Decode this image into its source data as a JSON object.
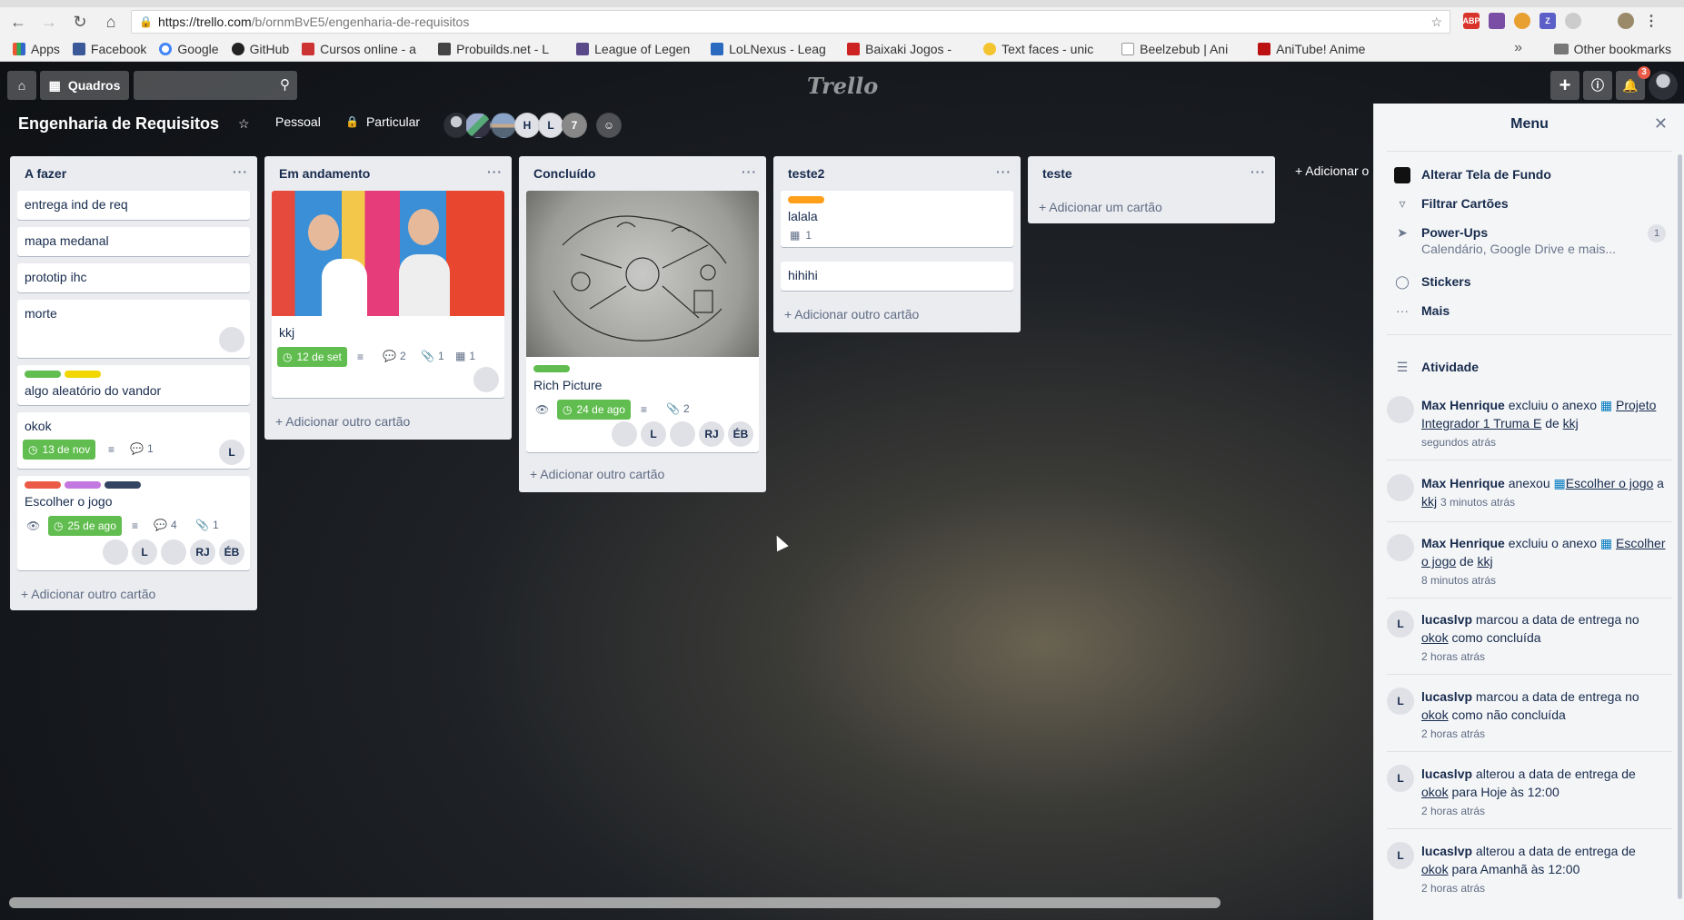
{
  "browser": {
    "url_host": "https://trello.com",
    "url_path": "/b/ornmBvE5/engenharia-de-requisitos",
    "bookmarks": [
      "Apps",
      "Facebook",
      "Google",
      "GitHub",
      "Cursos online - a",
      "Probuilds.net - L",
      "League of Legen",
      "LoLNexus - Leag",
      "Baixaki Jogos -",
      "Text faces - unic",
      "Beelzebub | Ani",
      "AniTube! Anime"
    ],
    "more": "»",
    "other_bookmarks": "Other bookmarks",
    "extensions": [
      "ABP",
      "",
      "",
      "Z",
      "",
      ""
    ]
  },
  "header": {
    "boards_label": "Quadros",
    "logo": "Trello",
    "notif_count": "3"
  },
  "board": {
    "title": "Engenharia de Requisitos",
    "team": "Pessoal",
    "visibility": "Particular",
    "members": [
      "",
      "",
      "",
      "H",
      "L",
      "7"
    ]
  },
  "lists": [
    {
      "name": "A fazer",
      "cards": [
        "entrega ind de req",
        "mapa medanal",
        "prototip ihc",
        "morte",
        "algo aleatório do vandor",
        "okok",
        "Escolher o jogo"
      ],
      "okok": {
        "date": "13 de nov",
        "comments": "1",
        "member": "L"
      },
      "jogo": {
        "date": "25 de ago",
        "comments": "4",
        "attachments": "1",
        "members": [
          "L",
          "RJ",
          "ÉB"
        ]
      },
      "add": "Adicionar outro cartão"
    },
    {
      "name": "Em andamento",
      "cards": [
        "kkj"
      ],
      "kkj": {
        "date": "12 de set",
        "comments": "2",
        "attachments": "1",
        "checklist": "1"
      },
      "add": "Adicionar outro cartão"
    },
    {
      "name": "Concluído",
      "cards": [
        "Rich Picture"
      ],
      "rich": {
        "date": "24 de ago",
        "attachments": "2",
        "members": [
          "L",
          "RJ",
          "ÉB"
        ]
      },
      "add": "Adicionar outro cartão"
    },
    {
      "name": "teste2",
      "cards": [
        "lalala",
        "hihihi"
      ],
      "lalala": {
        "checklist": "1"
      },
      "add": "Adicionar outro cartão"
    },
    {
      "name": "teste",
      "cards": [],
      "add": "Adicionar um cartão"
    }
  ],
  "add_list": "Adicionar o",
  "menu": {
    "title": "Menu",
    "items": [
      "Alterar Tela de Fundo",
      "Filtrar Cartões",
      "Power-Ups",
      "Stickers",
      "Mais"
    ],
    "powerups_sub": "Calendário, Google Drive e mais...",
    "powerups_count": "1",
    "activity_title": "Atividade",
    "activity": [
      {
        "user": "Max Henrique",
        "pre": "excluiu o anexo",
        "link": "Projeto Integrador 1 Truma E",
        "mid": "de",
        "target": "kkj",
        "time": "segundos atrás"
      },
      {
        "user": "Max Henrique",
        "pre": "anexou",
        "link": "Escolher o jogo",
        "mid": "a",
        "target": "kkj",
        "time": "3 minutos atrás"
      },
      {
        "user": "Max Henrique",
        "pre": "excluiu o anexo",
        "link": "Escolher o jogo",
        "mid": "de",
        "target": "kkj",
        "time": "8 minutos atrás"
      },
      {
        "user": "lucaslvp",
        "pre": "marcou a data de entrega no",
        "link": "okok",
        "post": "como concluída",
        "time": "2 horas atrás",
        "avatar": "L"
      },
      {
        "user": "lucaslvp",
        "pre": "marcou a data de entrega no",
        "link": "okok",
        "post": "como não concluída",
        "time": "2 horas atrás",
        "avatar": "L"
      },
      {
        "user": "lucaslvp",
        "pre": "alterou a data de entrega de",
        "link": "okok",
        "post": "para Hoje às 12:00",
        "time": "2 horas atrás",
        "avatar": "L"
      },
      {
        "user": "lucaslvp",
        "pre": "alterou a data de entrega de",
        "link": "okok",
        "post": "para Amanhã às 12:00",
        "time": "2 horas atrás",
        "avatar": "L"
      }
    ]
  },
  "colors": {
    "green": "#61bd4f",
    "yellow": "#f2d600",
    "orange": "#ff9f1a",
    "red": "#eb5a46",
    "purple": "#c377e0",
    "navy": "#344563"
  }
}
